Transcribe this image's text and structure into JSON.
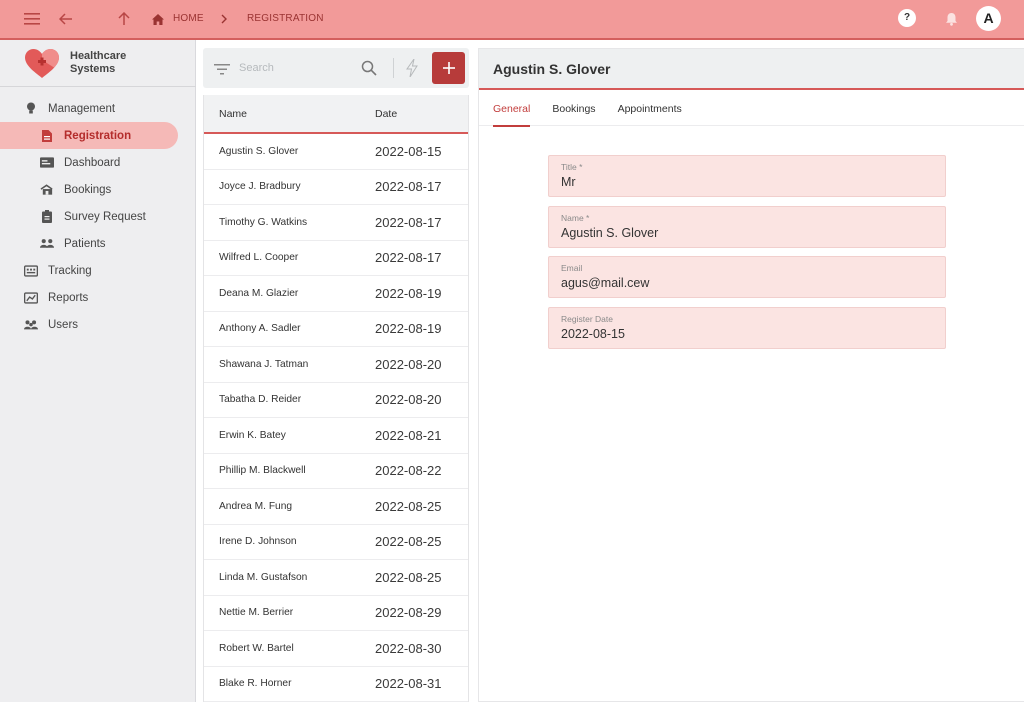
{
  "topbar": {
    "breadcrumb": [
      "HOME",
      "REGISTRATION"
    ],
    "help_label": "?",
    "avatar_initial": "A"
  },
  "sidebar": {
    "brand": "Healthcare Systems",
    "items": [
      {
        "label": "Management",
        "icon": "lightbulb-icon",
        "level": 0
      },
      {
        "label": "Registration",
        "icon": "document-icon",
        "level": 1,
        "active": true
      },
      {
        "label": "Dashboard",
        "icon": "dashboard-icon",
        "level": 1
      },
      {
        "label": "Bookings",
        "icon": "bookings-icon",
        "level": 1
      },
      {
        "label": "Survey Request",
        "icon": "clipboard-icon",
        "level": 1
      },
      {
        "label": "Patients",
        "icon": "patients-icon",
        "level": 1
      },
      {
        "label": "Tracking",
        "icon": "tracking-icon",
        "level": 0
      },
      {
        "label": "Reports",
        "icon": "reports-icon",
        "level": 0
      },
      {
        "label": "Users",
        "icon": "users-icon",
        "level": 0
      }
    ]
  },
  "list": {
    "search_placeholder": "Search",
    "columns": [
      "Name",
      "Date"
    ],
    "rows": [
      {
        "name": "Agustin S. Glover",
        "date": "2022-08-15"
      },
      {
        "name": "Joyce J. Bradbury",
        "date": "2022-08-17"
      },
      {
        "name": "Timothy G. Watkins",
        "date": "2022-08-17"
      },
      {
        "name": "Wilfred L. Cooper",
        "date": "2022-08-17"
      },
      {
        "name": "Deana M. Glazier",
        "date": "2022-08-19"
      },
      {
        "name": "Anthony A. Sadler",
        "date": "2022-08-19"
      },
      {
        "name": "Shawana J. Tatman",
        "date": "2022-08-20"
      },
      {
        "name": "Tabatha D. Reider",
        "date": "2022-08-20"
      },
      {
        "name": "Erwin K. Batey",
        "date": "2022-08-21"
      },
      {
        "name": "Phillip M. Blackwell",
        "date": "2022-08-22"
      },
      {
        "name": "Andrea M. Fung",
        "date": "2022-08-25"
      },
      {
        "name": "Irene D. Johnson",
        "date": "2022-08-25"
      },
      {
        "name": "Linda M. Gustafson",
        "date": "2022-08-25"
      },
      {
        "name": "Nettie M. Berrier",
        "date": "2022-08-29"
      },
      {
        "name": "Robert W. Bartel",
        "date": "2022-08-30"
      },
      {
        "name": "Blake R. Horner",
        "date": "2022-08-31"
      }
    ]
  },
  "detail": {
    "title": "Agustin S. Glover",
    "tabs": [
      "General",
      "Bookings",
      "Appointments"
    ],
    "fields": [
      {
        "label": "Title *",
        "value": "Mr"
      },
      {
        "label": "Name *",
        "value": "Agustin S. Glover"
      },
      {
        "label": "Email",
        "value": "agus@mail.cew"
      },
      {
        "label": "Register Date",
        "value": "2022-08-15"
      }
    ]
  },
  "colors": {
    "topbar": "#f29a99",
    "accent": "#b73b3a",
    "active_nav": "#f5b9b7",
    "field_bg": "#fbe4e2"
  }
}
